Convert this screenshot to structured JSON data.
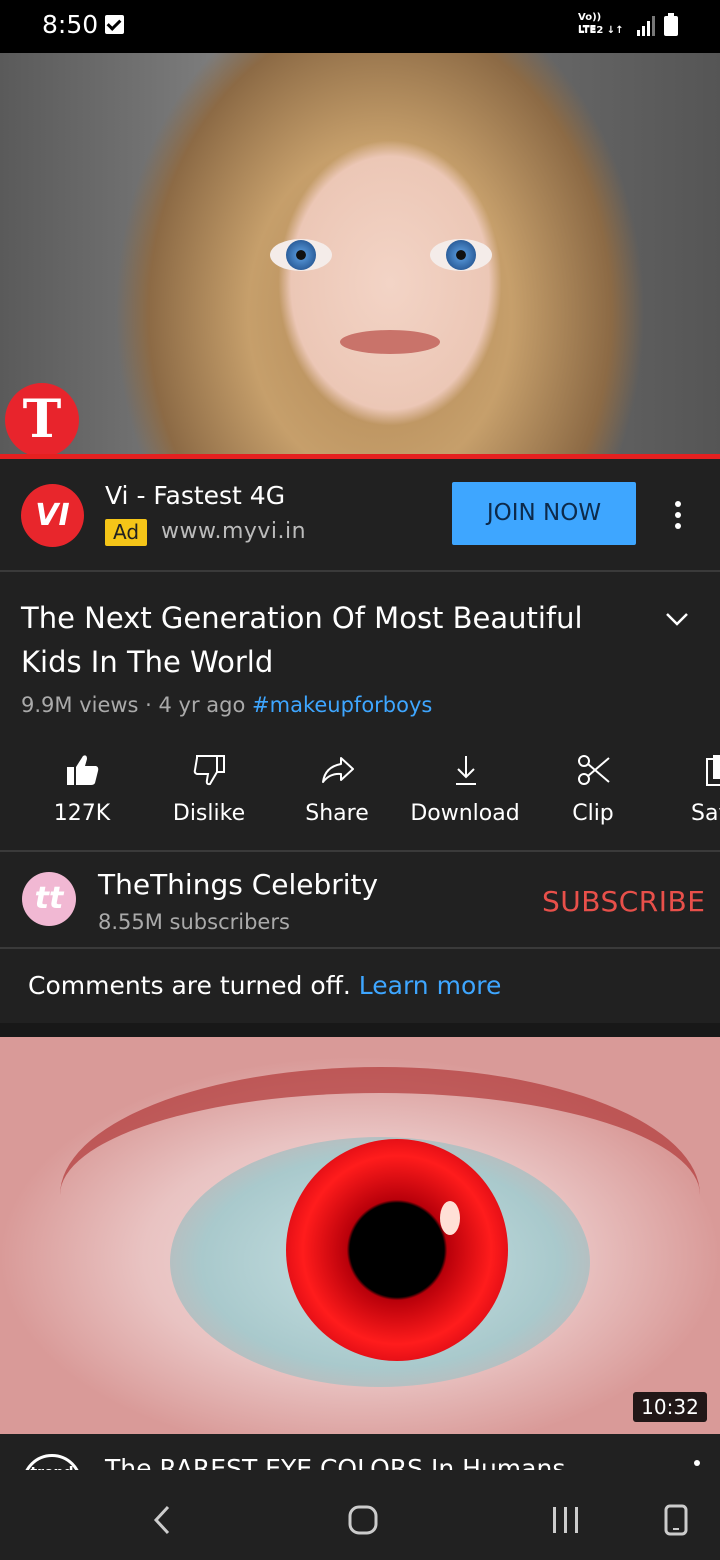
{
  "status_bar": {
    "time": "8:50",
    "network_top": "Vo)) LTE",
    "network_bottom": "LTE2 ↓↑",
    "icons": [
      "checkbox-notification-icon",
      "signal-icon",
      "battery-icon"
    ]
  },
  "player": {
    "channel_logo_letter": "T",
    "progress_color": "#e52020"
  },
  "ad": {
    "logo_text": "VI",
    "title": "Vi - Fastest 4G",
    "badge": "Ad",
    "url": "www.myvi.in",
    "cta": "JOIN NOW"
  },
  "video": {
    "title": "The Next Generation Of Most Beautiful Kids In The World",
    "views": "9.9M views · 4 yr ago",
    "hashtag": "#makeupforboys"
  },
  "actions": [
    {
      "label": "127K",
      "icon": "like-icon"
    },
    {
      "label": "Dislike",
      "icon": "dislike-icon"
    },
    {
      "label": "Share",
      "icon": "share-icon"
    },
    {
      "label": "Download",
      "icon": "download-icon"
    },
    {
      "label": "Clip",
      "icon": "clip-icon"
    },
    {
      "label": "Sav",
      "icon": "save-icon"
    }
  ],
  "channel": {
    "avatar_text": "tt",
    "name": "TheThings Celebrity",
    "subscribers": "8.55M subscribers",
    "subscribe_label": "SUBSCRIBE"
  },
  "comments": {
    "text": "Comments are turned off.",
    "link": "Learn more"
  },
  "next_video": {
    "duration": "10:32",
    "avatar_text": "trend",
    "title": "The RAREST EYE COLORS In Humans"
  },
  "colors": {
    "accent_blue": "#3ea6ff",
    "subscribe_red": "#e8504a",
    "background": "#212121"
  }
}
